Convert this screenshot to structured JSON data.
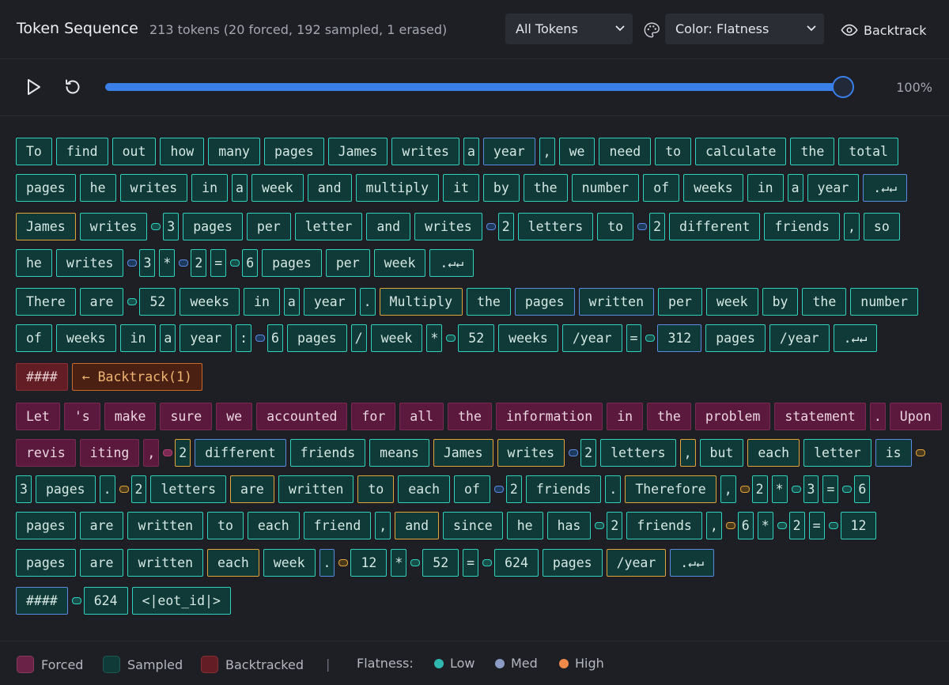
{
  "header": {
    "title": "Token Sequence",
    "stats": "213 tokens (20 forced, 192 sampled, 1 erased)",
    "filter": {
      "selected": "All Tokens"
    },
    "color_mode": {
      "selected": "Color: Flatness"
    },
    "backtrack_label": "Backtrack"
  },
  "playback": {
    "progress": 1.0,
    "percent_label": "100%"
  },
  "colors": {
    "low": "#2fd1bd",
    "med": "#5b8ae0",
    "high": "#e0a43a",
    "accent": "#3a7ee8"
  },
  "icons": [
    "play-icon",
    "reset-icon",
    "palette-icon",
    "eye-icon",
    "chevron-down-icon"
  ],
  "lines": [
    [
      [
        "To",
        ""
      ],
      [
        "find",
        ""
      ],
      [
        "out",
        ""
      ],
      [
        "how",
        ""
      ],
      [
        "many",
        ""
      ],
      [
        "pages",
        ""
      ],
      [
        "James",
        ""
      ],
      [
        "writes",
        ""
      ],
      [
        "a",
        ""
      ],
      [
        "year",
        "m"
      ],
      [
        ",",
        ""
      ],
      [
        "we",
        ""
      ],
      [
        "need",
        ""
      ],
      [
        "to",
        ""
      ],
      [
        "calculate",
        ""
      ],
      [
        "the",
        ""
      ],
      [
        "total",
        ""
      ]
    ],
    [
      [
        "pages",
        ""
      ],
      [
        "he",
        ""
      ],
      [
        "writes",
        ""
      ],
      [
        "in",
        ""
      ],
      [
        "a",
        ""
      ],
      [
        "week",
        ""
      ],
      [
        "and",
        ""
      ],
      [
        "multiply",
        ""
      ],
      [
        "it",
        ""
      ],
      [
        "by",
        ""
      ],
      [
        "the",
        ""
      ],
      [
        "number",
        ""
      ],
      [
        "of",
        ""
      ],
      [
        "weeks",
        ""
      ],
      [
        "in",
        ""
      ],
      [
        "a",
        ""
      ],
      [
        "year",
        ""
      ],
      [
        ".↵↵",
        "m"
      ]
    ],
    [
      [
        "James",
        "h"
      ],
      [
        "writes",
        ""
      ],
      [
        "_",
        ""
      ],
      [
        "3",
        ""
      ],
      [
        "pages",
        ""
      ],
      [
        "per",
        ""
      ],
      [
        "letter",
        ""
      ],
      [
        "and",
        ""
      ],
      [
        "writes",
        ""
      ],
      [
        "_",
        "m"
      ],
      [
        "2",
        ""
      ],
      [
        "letters",
        ""
      ],
      [
        "to",
        ""
      ],
      [
        "_",
        "m"
      ],
      [
        "2",
        ""
      ],
      [
        "different",
        ""
      ],
      [
        "friends",
        ""
      ],
      [
        ",",
        ""
      ],
      [
        "so",
        ""
      ]
    ],
    [
      [
        "he",
        ""
      ],
      [
        "writes",
        ""
      ],
      [
        "_",
        "m"
      ],
      [
        "3",
        ""
      ],
      [
        "*",
        ""
      ],
      [
        "_",
        "m"
      ],
      [
        "2",
        ""
      ],
      [
        "=",
        ""
      ],
      [
        "_",
        ""
      ],
      [
        "6",
        ""
      ],
      [
        "pages",
        ""
      ],
      [
        "per",
        ""
      ],
      [
        "week",
        ""
      ],
      [
        ".↵↵",
        ""
      ]
    ],
    [
      [
        "There",
        ""
      ],
      [
        "are",
        ""
      ],
      [
        "_",
        ""
      ],
      [
        "52",
        ""
      ],
      [
        "weeks",
        ""
      ],
      [
        "in",
        ""
      ],
      [
        "a",
        ""
      ],
      [
        "year",
        ""
      ],
      [
        ".",
        ""
      ],
      [
        "Multiply",
        "h"
      ],
      [
        "the",
        ""
      ],
      [
        "pages",
        "m"
      ],
      [
        "written",
        "m"
      ],
      [
        "per",
        ""
      ],
      [
        "week",
        ""
      ],
      [
        "by",
        ""
      ],
      [
        "the",
        ""
      ],
      [
        "number",
        ""
      ]
    ],
    [
      [
        "of",
        ""
      ],
      [
        "weeks",
        ""
      ],
      [
        "in",
        ""
      ],
      [
        "a",
        ""
      ],
      [
        "year",
        ""
      ],
      [
        ":",
        ""
      ],
      [
        "_",
        "m"
      ],
      [
        "6",
        ""
      ],
      [
        "pages",
        ""
      ],
      [
        "/",
        ""
      ],
      [
        "week",
        ""
      ],
      [
        "*",
        ""
      ],
      [
        "_",
        ""
      ],
      [
        "52",
        ""
      ],
      [
        "weeks",
        ""
      ],
      [
        "/year",
        ""
      ],
      [
        "=",
        ""
      ],
      [
        "_",
        ""
      ],
      [
        "312",
        "m"
      ],
      [
        "pages",
        ""
      ],
      [
        "/year",
        ""
      ],
      [
        ".↵↵",
        ""
      ]
    ],
    [
      [
        "####",
        "e"
      ],
      [
        "← Backtrack(1)",
        "b"
      ]
    ],
    [
      [
        "Let",
        "f"
      ],
      [
        "'s",
        "f"
      ],
      [
        "make",
        "f"
      ],
      [
        "sure",
        "f"
      ],
      [
        "we",
        "f"
      ],
      [
        "accounted",
        "f"
      ],
      [
        "for",
        "f"
      ],
      [
        "all",
        "f"
      ],
      [
        "the",
        "f"
      ],
      [
        "information",
        "f"
      ],
      [
        "in",
        "f"
      ],
      [
        "the",
        "f"
      ],
      [
        "problem",
        "f"
      ],
      [
        "statement",
        "f"
      ],
      [
        ".",
        "f"
      ],
      [
        "Upon",
        "f"
      ]
    ],
    [
      [
        "revis",
        "f"
      ],
      [
        "iting",
        "f"
      ],
      [
        ",",
        "f"
      ],
      [
        "_",
        "f"
      ],
      [
        "2",
        "h"
      ],
      [
        "different",
        "m"
      ],
      [
        "friends",
        ""
      ],
      [
        "means",
        ""
      ],
      [
        "James",
        "h"
      ],
      [
        "writes",
        "h"
      ],
      [
        "_",
        "m"
      ],
      [
        "2",
        ""
      ],
      [
        "letters",
        ""
      ],
      [
        ",",
        "h"
      ],
      [
        "but",
        ""
      ],
      [
        "each",
        "h"
      ],
      [
        "letter",
        ""
      ],
      [
        "is",
        "m"
      ],
      [
        "_",
        "h"
      ]
    ],
    [
      [
        "3",
        ""
      ],
      [
        "pages",
        ""
      ],
      [
        ".",
        ""
      ],
      [
        "_",
        "h"
      ],
      [
        "2",
        ""
      ],
      [
        "letters",
        ""
      ],
      [
        "are",
        "h"
      ],
      [
        "written",
        ""
      ],
      [
        "to",
        "h"
      ],
      [
        "each",
        ""
      ],
      [
        "of",
        ""
      ],
      [
        "_",
        "m"
      ],
      [
        "2",
        ""
      ],
      [
        "friends",
        ""
      ],
      [
        ".",
        ""
      ],
      [
        "Therefore",
        "h"
      ],
      [
        ",",
        ""
      ],
      [
        "_",
        "h"
      ],
      [
        "2",
        ""
      ],
      [
        "*",
        ""
      ],
      [
        "_",
        ""
      ],
      [
        "3",
        ""
      ],
      [
        "=",
        ""
      ],
      [
        "_",
        ""
      ],
      [
        "6",
        ""
      ]
    ],
    [
      [
        "pages",
        ""
      ],
      [
        "are",
        ""
      ],
      [
        "written",
        ""
      ],
      [
        "to",
        ""
      ],
      [
        "each",
        ""
      ],
      [
        "friend",
        ""
      ],
      [
        ",",
        ""
      ],
      [
        "and",
        "h"
      ],
      [
        "since",
        ""
      ],
      [
        "he",
        ""
      ],
      [
        "has",
        ""
      ],
      [
        "_",
        ""
      ],
      [
        "2",
        ""
      ],
      [
        "friends",
        ""
      ],
      [
        ",",
        ""
      ],
      [
        "_",
        "h"
      ],
      [
        "6",
        ""
      ],
      [
        "*",
        ""
      ],
      [
        "_",
        ""
      ],
      [
        "2",
        ""
      ],
      [
        "=",
        ""
      ],
      [
        "_",
        ""
      ],
      [
        "12",
        ""
      ]
    ],
    [
      [
        "pages",
        ""
      ],
      [
        "are",
        ""
      ],
      [
        "written",
        ""
      ],
      [
        "each",
        "h"
      ],
      [
        "week",
        ""
      ],
      [
        ".",
        "m"
      ],
      [
        "_",
        "h"
      ],
      [
        "12",
        ""
      ],
      [
        "*",
        ""
      ],
      [
        "_",
        ""
      ],
      [
        "52",
        ""
      ],
      [
        "=",
        ""
      ],
      [
        "_",
        ""
      ],
      [
        "624",
        ""
      ],
      [
        "pages",
        ""
      ],
      [
        "/year",
        "h"
      ],
      [
        ".↵↵",
        "m"
      ]
    ],
    [
      [
        "####",
        "m"
      ],
      [
        "_",
        ""
      ],
      [
        "624",
        ""
      ],
      [
        "<|eot_id|>",
        ""
      ]
    ]
  ],
  "legend": {
    "forced": "Forced",
    "sampled": "Sampled",
    "backtracked": "Backtracked",
    "divider": "|",
    "flatness_label": "Flatness:",
    "low": "Low",
    "med": "Med",
    "high": "High"
  }
}
